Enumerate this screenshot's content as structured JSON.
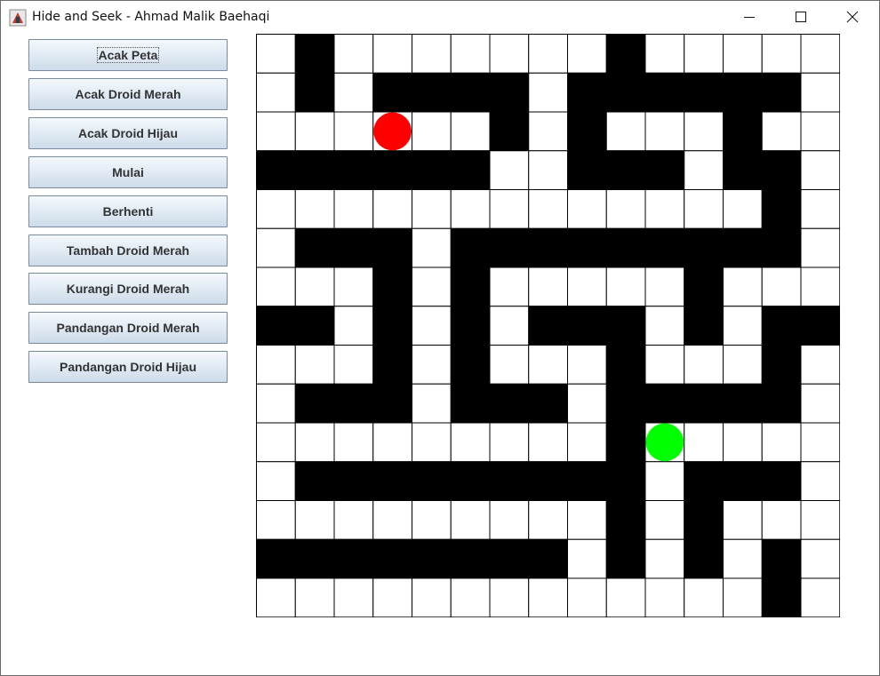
{
  "window": {
    "title": "Hide and Seek - Ahmad Malik Baehaqi",
    "icon": "java-app-icon",
    "controls": [
      "minimize-icon",
      "maximize-icon",
      "close-icon"
    ]
  },
  "buttons": [
    {
      "label": "Acak Peta",
      "focused": true
    },
    {
      "label": "Acak Droid Merah"
    },
    {
      "label": "Acak Droid Hijau"
    },
    {
      "label": "Mulai"
    },
    {
      "label": "Berhenti"
    },
    {
      "label": "Tambah Droid Merah"
    },
    {
      "label": "Kurangi Droid Merah"
    },
    {
      "label": "Pandangan Droid Merah"
    },
    {
      "label": "Pandangan Droid Hijau"
    }
  ],
  "maze": {
    "rows": 15,
    "cols": 15,
    "grid": [
      "010000000100000",
      "010111101111110",
      "000000101000100",
      "111111001110110",
      "000000000000010",
      "011101111111110",
      "000101000001000",
      "110101011101011",
      "000101000100010",
      "011101110111110",
      "000000000100000",
      "011111111101110",
      "000000000101000",
      "111111110101010",
      "000000000000010"
    ],
    "wall_color": "#000000",
    "floor_color": "#ffffff",
    "grid_line_color": "#000000",
    "droids": [
      {
        "type": "red",
        "row": 2,
        "col": 3,
        "color": "#ff0000"
      },
      {
        "type": "green",
        "row": 10,
        "col": 10,
        "color": "#00ff00"
      }
    ]
  }
}
